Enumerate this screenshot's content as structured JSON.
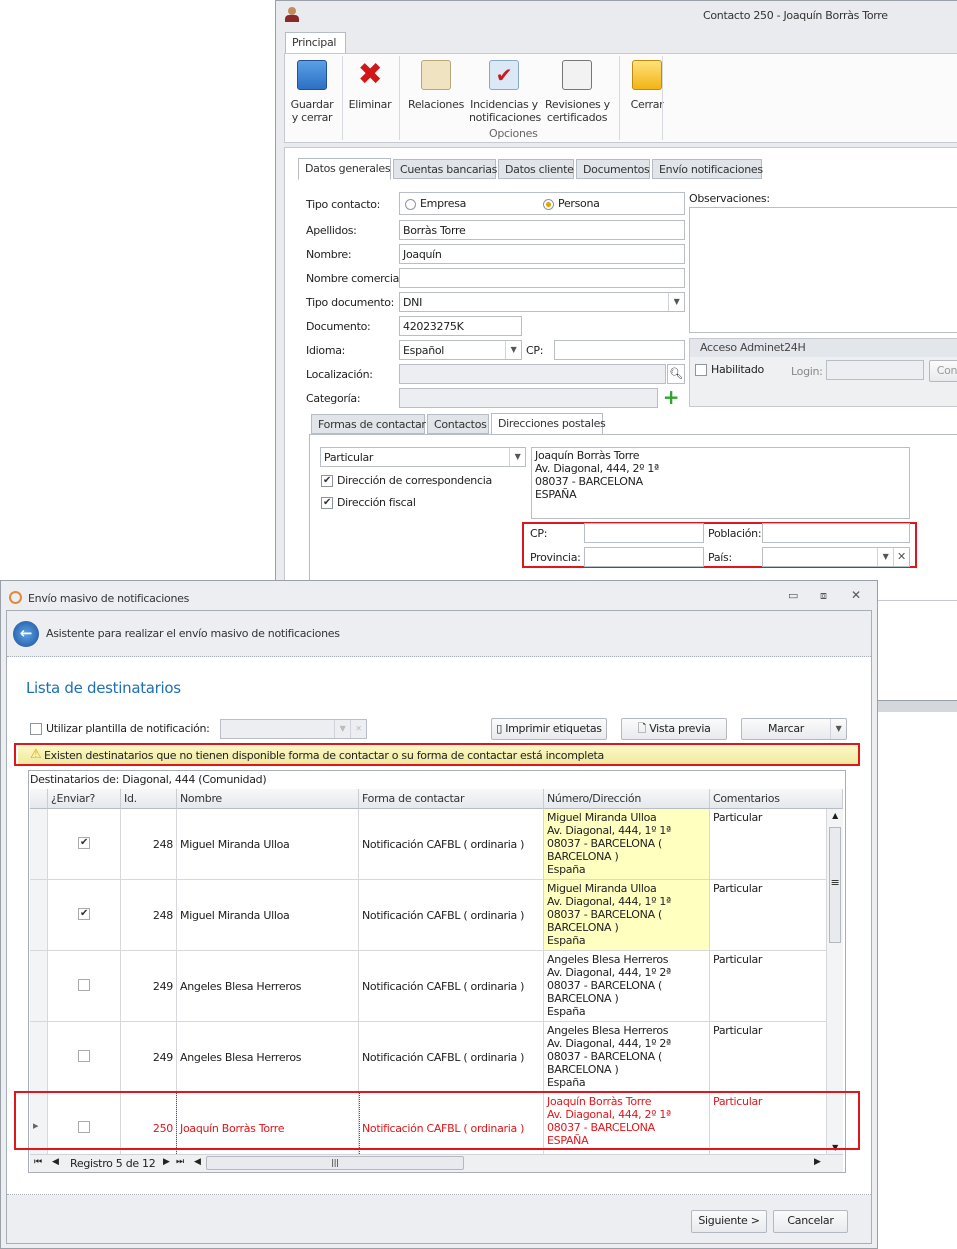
{
  "contact_window": {
    "title": "Contacto 250 - Joaquín Borràs Torre",
    "ribbon_tab": "Principal",
    "buttons": {
      "save": "Guardar\ny cerrar",
      "delete": "Eliminar",
      "relations": "Relaciones",
      "incidents": "Incidencias y\nnotificaciones",
      "revisions": "Revisiones y\ncertificados",
      "close": "Cerrar"
    },
    "group_label": "Opciones",
    "tabs": [
      "Datos generales",
      "Cuentas bancarias",
      "Datos cliente",
      "Documentos",
      "Envío notificaciones"
    ],
    "form": {
      "tipo_contacto_label": "Tipo contacto:",
      "empresa": "Empresa",
      "persona": "Persona",
      "apellidos_label": "Apellidos:",
      "apellidos": "Borràs Torre",
      "nombre_label": "Nombre:",
      "nombre": "Joaquín",
      "nombre_comercial_label": "Nombre comercial:",
      "nombre_comercial": "",
      "tipo_documento_label": "Tipo documento:",
      "tipo_documento": "DNI",
      "documento_label": "Documento:",
      "documento": "42023275K",
      "idioma_label": "Idioma:",
      "idioma": "Español",
      "cp_label": "CP:",
      "cp": "",
      "localizacion_label": "Localización:",
      "categoria_label": "Categoría:",
      "observaciones_label": "Observaciones:"
    },
    "acceso": {
      "title": "Acceso Adminet24H",
      "habilitado": "Habilitado",
      "login_label": "Login:",
      "cont_button": "Cont"
    },
    "subtabs": [
      "Formas de contactar",
      "Contactos",
      "Direcciones postales"
    ],
    "direcciones": {
      "tipo": "Particular",
      "correspondencia": "Dirección de correspondencia",
      "fiscal": "Dirección fiscal",
      "address": "Joaquín Borràs Torre\nAv. Diagonal, 444, 2º 1ª\n08037 - BARCELONA\nESPAÑA",
      "cp_label": "CP:",
      "poblacion_label": "Población:",
      "provincia_label": "Provincia:",
      "pais_label": "País:"
    }
  },
  "dialog": {
    "title": "Envío masivo de notificaciones",
    "header": "Asistente para realizar el envío masivo de notificaciones",
    "section_title": "Lista de destinatarios",
    "template_label": "Utilizar plantilla de notificación:",
    "print_labels": "Imprimir etiquetas",
    "preview": "Vista previa",
    "mark": "Marcar",
    "warning": "Existen destinatarios que no tienen disponible forma de contactar o su forma de contactar está incompleta",
    "grid_caption": "Destinatarios de: Diagonal, 444 (Comunidad)",
    "columns": [
      "¿Enviar?",
      "Id.",
      "Nombre",
      "Forma de contactar",
      "Número/Dirección",
      "Comentarios"
    ],
    "rows": [
      {
        "send": true,
        "id": "248",
        "name": "Miguel Miranda Ulloa",
        "method": "Notificación CAFBL ( ordinaria )",
        "address": "Miguel Miranda Ulloa\nAv. Diagonal, 444, 1º 1ª\n08037 - BARCELONA (\nBARCELONA )\nEspaña",
        "comment": "Particular",
        "highlight": true,
        "error": false
      },
      {
        "send": true,
        "id": "248",
        "name": "Miguel Miranda Ulloa",
        "method": "Notificación CAFBL ( ordinaria )",
        "address": "Miguel Miranda Ulloa\nAv. Diagonal, 444, 1º 1ª\n08037 - BARCELONA (\nBARCELONA )\nEspaña",
        "comment": "Particular",
        "highlight": true,
        "error": false
      },
      {
        "send": false,
        "id": "249",
        "name": "Angeles Blesa Herreros",
        "method": "Notificación CAFBL ( ordinaria )",
        "address": "Angeles Blesa Herreros\nAv. Diagonal, 444, 1º 2ª\n08037 - BARCELONA (\nBARCELONA )\nEspaña",
        "comment": "Particular",
        "highlight": false,
        "error": false
      },
      {
        "send": false,
        "id": "249",
        "name": "Angeles Blesa Herreros",
        "method": "Notificación CAFBL ( ordinaria )",
        "address": "Angeles Blesa Herreros\nAv. Diagonal, 444, 1º 2ª\n08037 - BARCELONA (\nBARCELONA )\nEspaña",
        "comment": "Particular",
        "highlight": false,
        "error": false
      },
      {
        "send": false,
        "id": "250",
        "name": "Joaquín Borràs Torre",
        "method": "Notificación CAFBL ( ordinaria )",
        "address": "Joaquín Borràs Torre\nAv. Diagonal, 444, 2º 1ª\n08037 - BARCELONA\nESPAÑA",
        "comment": "Particular",
        "highlight": false,
        "error": true
      }
    ],
    "record_nav": "Registro 5 de 12",
    "next": "Siguiente >",
    "cancel": "Cancelar"
  },
  "colors": {
    "error": "#e0161b",
    "accent": "#1e6fb5",
    "highlight": "#ffffc0",
    "warning": "#f6f1a8"
  }
}
